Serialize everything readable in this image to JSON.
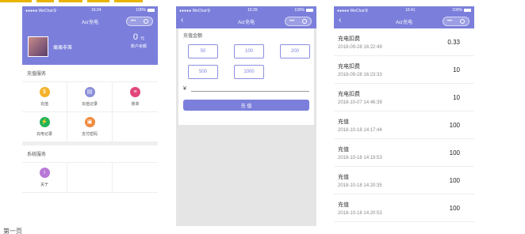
{
  "colors": {
    "accent": "#7b7fdb",
    "background": "#ffffff",
    "divider": "#eeeeee"
  },
  "phone1": {
    "status": {
      "carrier": "●●●●● WeChat令",
      "time": "16:24",
      "battery": "100%"
    },
    "nav": {
      "title": "Acr充电",
      "more": "•••",
      "close_icon": "target-icon"
    },
    "profile": {
      "name": "痛痛非酋",
      "balance": "0",
      "unit": "元",
      "balance_label": "账户余额"
    },
    "sections": [
      {
        "title": "充值服务",
        "items": [
          {
            "label": "充值",
            "icon": "money-bag-icon",
            "color": "#f3b229",
            "glyph": "$"
          },
          {
            "label": "充值记录",
            "icon": "document-icon",
            "color": "#8b8fd9",
            "glyph": "▤"
          },
          {
            "label": "账单",
            "icon": "bill-icon",
            "color": "#e2477a",
            "glyph": "≡"
          },
          {
            "label": "充电记录",
            "icon": "lightning-icon",
            "color": "#22b35a",
            "glyph": "⚡"
          },
          {
            "label": "支付密码",
            "icon": "lock-icon",
            "color": "#f08a3e",
            "glyph": "▣"
          }
        ]
      },
      {
        "title": "系统服务",
        "items": [
          {
            "label": "关于",
            "icon": "info-icon",
            "color": "#b778d6",
            "glyph": "i"
          }
        ]
      }
    ]
  },
  "phone2": {
    "status": {
      "carrier": "●●●●● WeChat令",
      "time": "16:39",
      "battery": "100%"
    },
    "nav": {
      "back": "‹",
      "title": "Acr充电",
      "more": "•••"
    },
    "form_title": "充值金额",
    "amounts": [
      "50",
      "100",
      "200",
      "500",
      "1000"
    ],
    "currency": "¥",
    "pay_label": "充 值"
  },
  "phone3": {
    "status": {
      "carrier": "●●●●● WeChat令",
      "time": "16:41",
      "battery": "100%"
    },
    "nav": {
      "back": "‹",
      "title": "Acr充电",
      "more": "•••"
    },
    "records": [
      {
        "type": "充电扣费",
        "date": "2018-09-28 16:22:49",
        "amount": "0.33"
      },
      {
        "type": "充电扣费",
        "date": "2018-09-28 16:23:33",
        "amount": "10"
      },
      {
        "type": "充电扣费",
        "date": "2018-10-07 14:46:39",
        "amount": "10"
      },
      {
        "type": "充值",
        "date": "2018-10-18 14:17:44",
        "amount": "100"
      },
      {
        "type": "充值",
        "date": "2018-10-18 14:19:53",
        "amount": "100"
      },
      {
        "type": "充值",
        "date": "2018-10-18 14:20:35",
        "amount": "100"
      },
      {
        "type": "充值",
        "date": "2018-10-18 14:20:53",
        "amount": "100"
      }
    ]
  },
  "bottom_caption": "第一页"
}
